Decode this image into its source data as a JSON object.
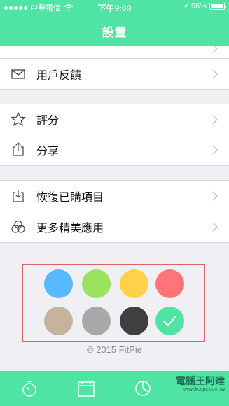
{
  "status_bar": {
    "carrier": "中華電信",
    "time": "下午9:03",
    "battery": "96%",
    "battery_level": 0.96
  },
  "header": {
    "title": "設置"
  },
  "settings": {
    "partial_item": {
      "label": "",
      "value": ""
    },
    "feedback": {
      "label": "用戶反饋",
      "icon": "mail-icon"
    },
    "rate": {
      "label": "評分",
      "icon": "star-icon"
    },
    "share": {
      "label": "分享",
      "icon": "share-icon"
    },
    "restore": {
      "label": "恢復已購項目",
      "icon": "restore-icon"
    },
    "more_apps": {
      "label": "更多精美應用",
      "icon": "apps-icon"
    }
  },
  "themes": {
    "colors": [
      "#58b9ff",
      "#9be35c",
      "#ffd24a",
      "#ff7478",
      "#c7b39b",
      "#a8a8a8",
      "#3f3f3f",
      "#4fe3a4"
    ],
    "selected_index": 7
  },
  "footer": {
    "copyright": "© 2015 FitPie"
  },
  "tabbar": {
    "tabs": [
      "stopwatch-icon",
      "calendar-icon",
      "chart-icon"
    ]
  },
  "watermark": {
    "text": "電腦王阿達",
    "sub": "www.kocpc.com.tw"
  }
}
